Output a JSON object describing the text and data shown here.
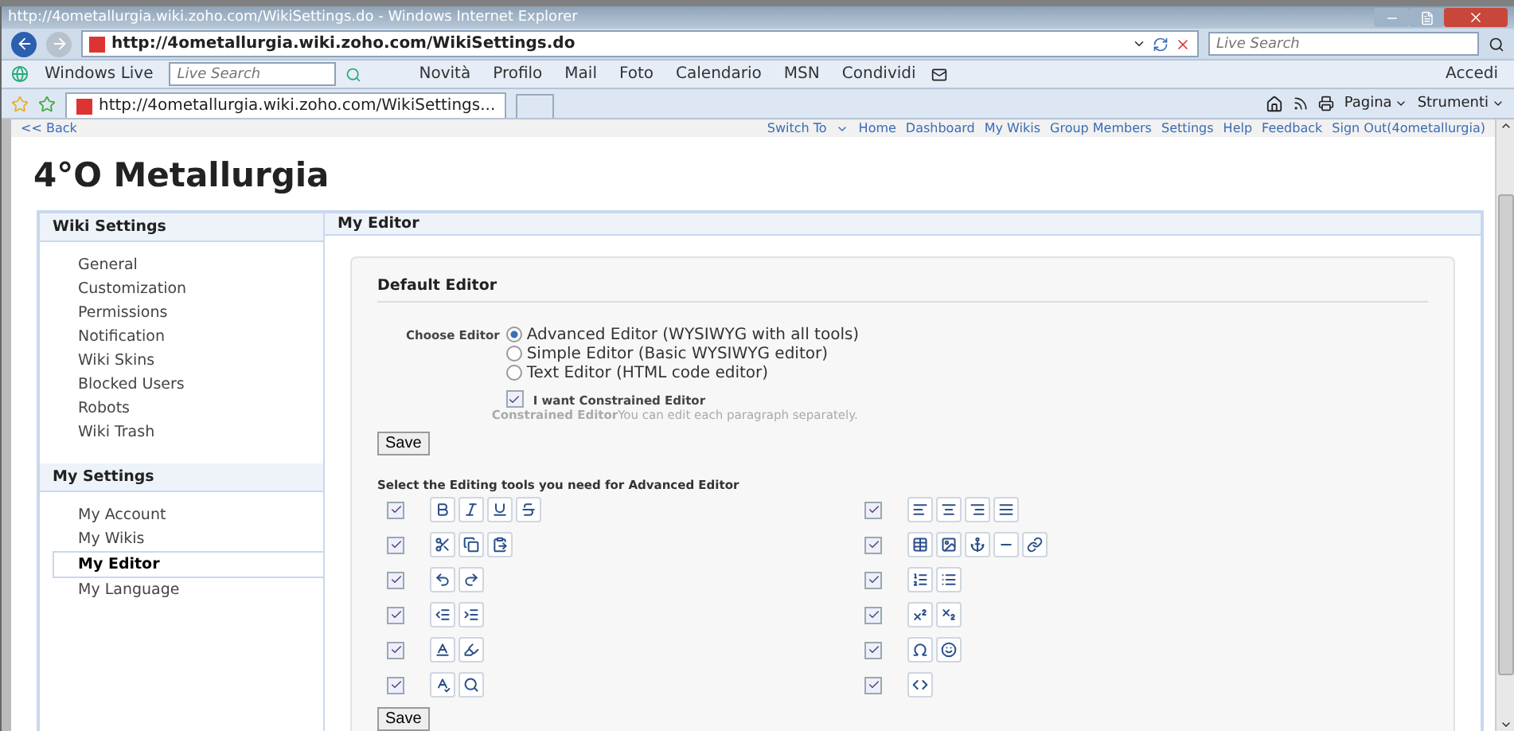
{
  "window": {
    "title": "http://4ometallurgia.wiki.zoho.com/WikiSettings.do - Windows Internet Explorer"
  },
  "address_bar": {
    "url": "http://4ometallurgia.wiki.zoho.com/WikiSettings.do",
    "search_placeholder": "Live Search"
  },
  "live_toolbar": {
    "brand": "Windows Live",
    "search_placeholder": "Live Search",
    "links": [
      "Novità",
      "Profilo",
      "Mail",
      "Foto",
      "Calendario",
      "MSN",
      "Condividi"
    ],
    "sign_in": "Accedi"
  },
  "tab_bar": {
    "tab": "http://4ometallurgia.wiki.zoho.com/WikiSettings...",
    "menus": [
      "Pagina",
      "Strumenti"
    ]
  },
  "page": {
    "back": "<< Back",
    "switch_to": "Switch To",
    "nav_links": [
      "Home",
      "Dashboard",
      "My Wikis",
      "Group Members",
      "Settings",
      "Help",
      "Feedback",
      "Sign Out(4ometallurgia)"
    ],
    "title": "4°O Metallurgia"
  },
  "sidebar": [
    {
      "heading": "Wiki Settings",
      "items": [
        {
          "label": "General",
          "selected": false
        },
        {
          "label": "Customization",
          "selected": false
        },
        {
          "label": "Permissions",
          "selected": false
        },
        {
          "label": "Notification",
          "selected": false
        },
        {
          "label": "Wiki Skins",
          "selected": false
        },
        {
          "label": "Blocked Users",
          "selected": false
        },
        {
          "label": "Robots",
          "selected": false
        },
        {
          "label": "Wiki Trash",
          "selected": false
        }
      ]
    },
    {
      "heading": "My Settings",
      "items": [
        {
          "label": "My Account",
          "selected": false
        },
        {
          "label": "My Wikis",
          "selected": false
        },
        {
          "label": "My Editor",
          "selected": true
        },
        {
          "label": "My Language",
          "selected": false
        }
      ]
    }
  ],
  "content": {
    "heading": "My Editor",
    "section": "Default Editor",
    "choose_label": "Choose Editor",
    "editors": [
      {
        "label": "Advanced Editor (WYSIWYG with all tools)",
        "selected": true
      },
      {
        "label": "Simple Editor (Basic WYSIWYG editor)",
        "selected": false
      },
      {
        "label": "Text Editor (HTML code editor)",
        "selected": false
      }
    ],
    "constrained": {
      "label": "I want Constrained Editor",
      "checked": true,
      "hint": "**Constrained Editor**You can edit each paragraph separately."
    },
    "save": "Save",
    "tools_label": "Select the Editing tools you need for Advanced Editor",
    "tool_groups": [
      {
        "checked": true,
        "tools": [
          {
            "kind": "bold"
          },
          {
            "kind": "italic"
          },
          {
            "kind": "underline"
          },
          {
            "kind": "strike"
          }
        ]
      },
      {
        "checked": true,
        "tools": [
          {
            "kind": "align-left"
          },
          {
            "kind": "align-center"
          },
          {
            "kind": "align-right"
          },
          {
            "kind": "justify"
          }
        ]
      },
      {
        "checked": true,
        "tools": [
          {
            "kind": "cut"
          },
          {
            "kind": "copy"
          },
          {
            "kind": "paste"
          }
        ]
      },
      {
        "checked": true,
        "tools": [
          {
            "kind": "table"
          },
          {
            "kind": "image"
          },
          {
            "kind": "anchor"
          },
          {
            "kind": "rule"
          },
          {
            "kind": "link"
          }
        ]
      },
      {
        "checked": true,
        "tools": [
          {
            "kind": "undo"
          },
          {
            "kind": "redo"
          }
        ]
      },
      {
        "checked": true,
        "tools": [
          {
            "kind": "ordered-list"
          },
          {
            "kind": "bullet-list"
          }
        ]
      },
      {
        "checked": true,
        "tools": [
          {
            "kind": "outdent"
          },
          {
            "kind": "indent"
          }
        ]
      },
      {
        "checked": true,
        "tools": [
          {
            "kind": "superscript"
          },
          {
            "kind": "subscript"
          }
        ]
      },
      {
        "checked": true,
        "tools": [
          {
            "kind": "font-color"
          },
          {
            "kind": "highlight"
          }
        ]
      },
      {
        "checked": true,
        "tools": [
          {
            "kind": "omega"
          },
          {
            "kind": "smiley"
          }
        ]
      },
      {
        "checked": true,
        "tools": [
          {
            "kind": "spellcheck"
          },
          {
            "kind": "find"
          }
        ]
      },
      {
        "checked": true,
        "tools": [
          {
            "kind": "code"
          }
        ]
      }
    ],
    "save_bottom": "Save"
  }
}
